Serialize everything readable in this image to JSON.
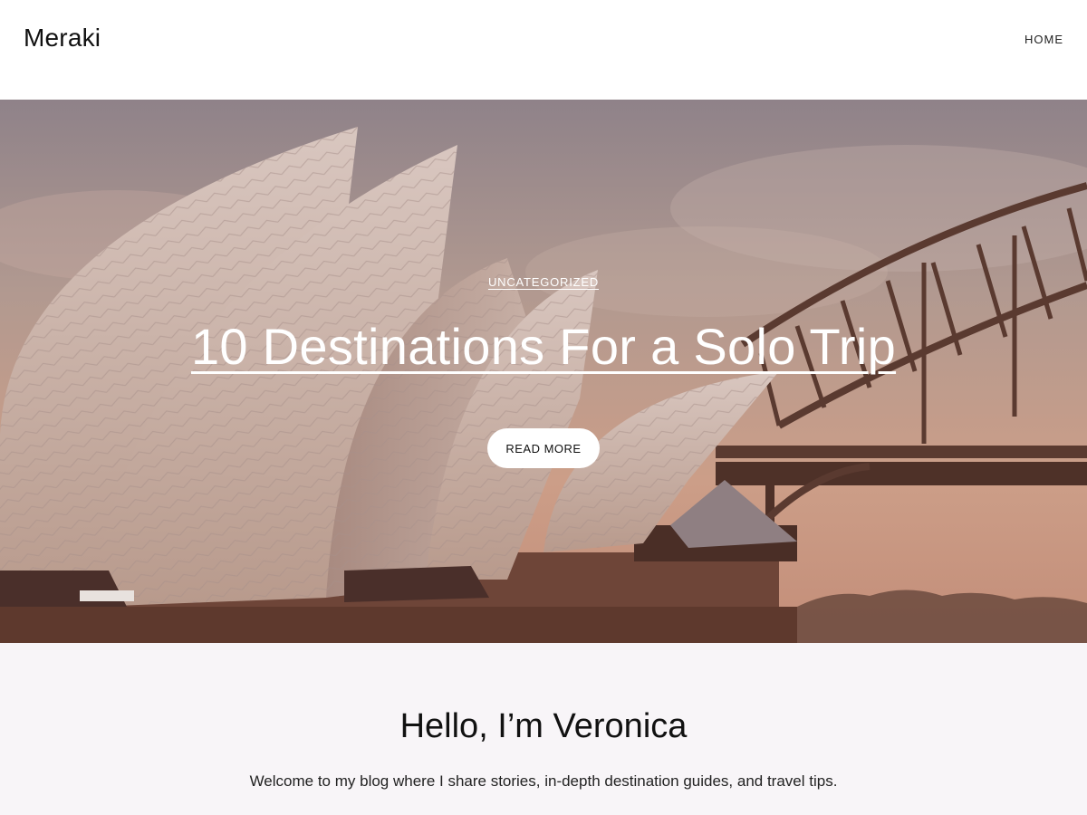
{
  "header": {
    "site_title": "Meraki",
    "nav": [
      {
        "label": "HOME"
      }
    ]
  },
  "hero": {
    "category": "UNCATEGORIZED",
    "title": "10 Destinations For a Solo Trip",
    "button_label": "READ MORE",
    "image_icon": "opera-house-harbour-bridge-photo"
  },
  "intro": {
    "heading": "Hello, I’m Veronica",
    "text": "Welcome to my blog where I share stories, in-depth destination guides, and travel tips."
  },
  "colors": {
    "intro_background": "#f8f5f8",
    "button_background": "#ffffff",
    "text_dark": "#111111"
  }
}
